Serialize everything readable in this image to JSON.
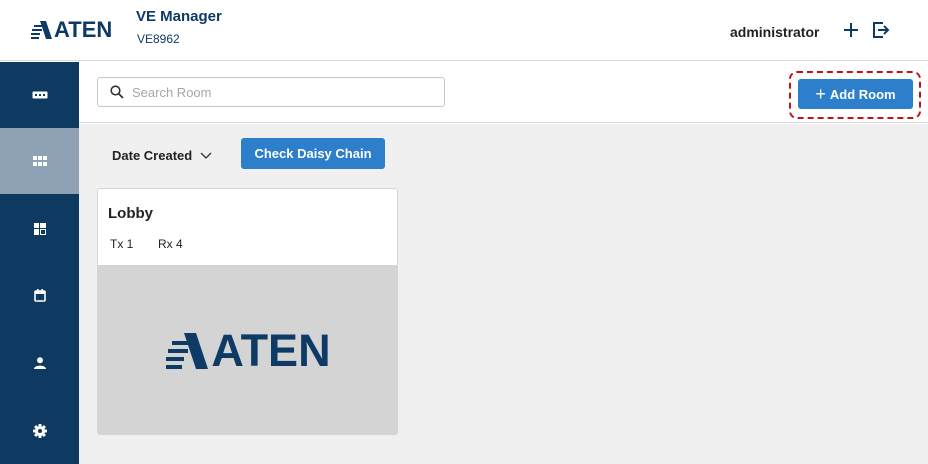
{
  "header": {
    "brand": "ATEN",
    "app_title": "VE Manager",
    "model": "VE8962",
    "user": "administrator",
    "icons": [
      "plus-icon",
      "logout-icon"
    ]
  },
  "sidebar": {
    "items": [
      {
        "icon": "device-icon",
        "active": false
      },
      {
        "icon": "grid-icon",
        "active": true
      },
      {
        "icon": "layout-icon",
        "active": false
      },
      {
        "icon": "calendar-icon",
        "active": false
      },
      {
        "icon": "user-icon",
        "active": false
      },
      {
        "icon": "gear-icon",
        "active": false
      }
    ]
  },
  "toolbar": {
    "search_placeholder": "Search Room",
    "add_room_label": "Add Room"
  },
  "content": {
    "sort_label": "Date Created",
    "daisy_chain_label": "Check Daisy Chain"
  },
  "rooms": [
    {
      "name": "Lobby",
      "tx": "Tx 1",
      "rx": "Rx 4",
      "image_brand": "ATEN"
    }
  ],
  "colors": {
    "sidebar": "#0e3a62",
    "sidebar_active": "#8fa2b5",
    "button": "#2d7fcb",
    "highlight": "#c0141b",
    "brand": "#0d3b66"
  }
}
